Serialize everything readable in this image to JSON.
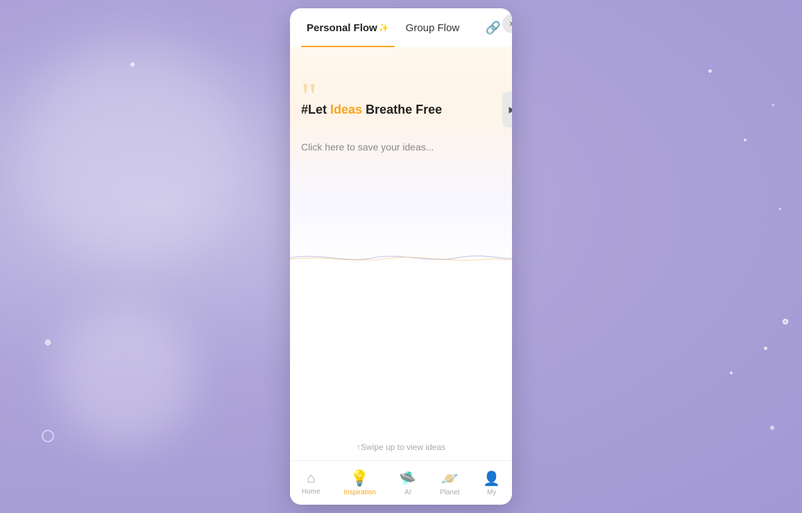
{
  "background": {
    "color": "#b8aee0"
  },
  "modal": {
    "close_label": "×",
    "expand_label": "▶"
  },
  "tabs": [
    {
      "id": "personal-flow",
      "label": "Personal Flow",
      "emoji": "✨",
      "active": true
    },
    {
      "id": "group-flow",
      "label": "Group Flow",
      "active": false
    }
  ],
  "link_icon": "🔗",
  "content": {
    "quote_mark": "““",
    "headline_prefix": "#Let ",
    "headline_highlight": "Ideas",
    "headline_suffix": " Breathe Free",
    "subtext": "Click here to save your ideas..."
  },
  "swipe_hint": "↑Swipe up to view ideas",
  "bottom_nav": [
    {
      "id": "home",
      "label": "Home",
      "icon": "⌂",
      "active": false
    },
    {
      "id": "inspiration",
      "label": "Inspiration",
      "icon": "💡",
      "active": true
    },
    {
      "id": "ai",
      "label": "AI",
      "icon": "🛸",
      "active": false
    },
    {
      "id": "planet",
      "label": "Planet",
      "icon": "🪐",
      "active": false
    },
    {
      "id": "my",
      "label": "My",
      "icon": "👤",
      "active": false
    }
  ]
}
